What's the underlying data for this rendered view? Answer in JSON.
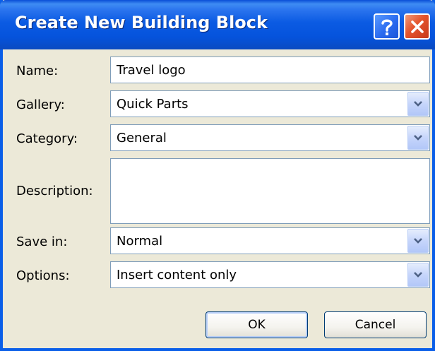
{
  "window": {
    "title": "Create New Building Block"
  },
  "titlebar": {
    "help_icon": "question-mark-icon",
    "close_icon": "close-x-icon"
  },
  "form": {
    "name": {
      "label": "Name:",
      "value": "Travel logo"
    },
    "gallery": {
      "label": "Gallery:",
      "value": "Quick Parts"
    },
    "category": {
      "label": "Category:",
      "value": "General"
    },
    "description": {
      "label": "Description:",
      "value": ""
    },
    "save_in": {
      "label": "Save in:",
      "value": "Normal"
    },
    "options": {
      "label": "Options:",
      "value": "Insert content only"
    }
  },
  "buttons": {
    "ok": "OK",
    "cancel": "Cancel"
  },
  "colors": {
    "titlebar": "#0553dc",
    "dialog_bg": "#ece9d8",
    "field_border": "#7f9db9",
    "close_button": "#e4542c"
  }
}
